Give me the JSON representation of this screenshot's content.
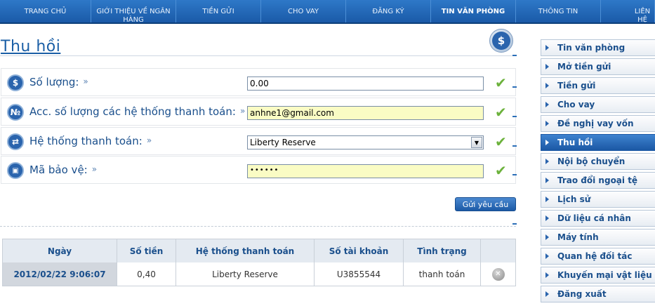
{
  "topnav": {
    "items": [
      {
        "label": "TRANG CHỦ"
      },
      {
        "label": "GIỚI THIỆU VỀ NGÂN HÀNG"
      },
      {
        "label": "TIỀN GỬI"
      },
      {
        "label": "CHO VAY"
      },
      {
        "label": "ĐĂNG KÝ"
      },
      {
        "label": "TIN VĂN PHÒNG"
      },
      {
        "label": "THÔNG TIN"
      },
      {
        "label": "LIÊN HỆ"
      }
    ],
    "active_index": 5
  },
  "page": {
    "title": "Thu hồi",
    "sign_icon_glyph": "$"
  },
  "form": {
    "chevron": "»",
    "rows": [
      {
        "label": "Số lượng:",
        "icon": "dollar-icon",
        "icon_glyph": "$",
        "value": "0.00",
        "type": "text"
      },
      {
        "label": "Acc. số lượng các hệ thống thanh toán:",
        "icon": "numero-icon",
        "icon_glyph": "№",
        "value": "anhne1@gmail.com",
        "type": "text-yellow"
      },
      {
        "label": "Hệ thống thanh toán:",
        "icon": "exchange-icon",
        "icon_glyph": "⇄",
        "value": "Liberty Reserve",
        "type": "select"
      },
      {
        "label": "Mã bảo vệ:",
        "icon": "lock-icon",
        "icon_glyph": "🔒",
        "value": "••••••",
        "type": "password"
      }
    ],
    "check_glyph": "✔",
    "submit_label": "Gửi yêu cầu"
  },
  "table": {
    "columns": [
      "Ngày",
      "Số tiền",
      "Hệ thống thanh toán",
      "Số tài khoản",
      "Tình trạng",
      ""
    ],
    "rows": [
      {
        "date": "2012/02/22 9:06:07",
        "amount": "0,40",
        "system": "Liberty Reserve",
        "account": "U3855544",
        "status": "thanh toán"
      }
    ],
    "delete_glyph": "✕"
  },
  "sidebar": {
    "items": [
      {
        "label": "Tin văn phòng"
      },
      {
        "label": "Mở tiền gửi"
      },
      {
        "label": "Tiền gửi"
      },
      {
        "label": "Cho vay"
      },
      {
        "label": "Đề nghị vay vốn"
      },
      {
        "label": "Thu hồi"
      },
      {
        "label": "Nội bộ chuyển"
      },
      {
        "label": "Trao đổi ngoại tệ"
      },
      {
        "label": "Lịch sử"
      },
      {
        "label": "Dữ liệu cá nhân"
      },
      {
        "label": "Máy tính"
      },
      {
        "label": "Quan hệ đối tác"
      },
      {
        "label": "Khuyến mại vật liệu"
      },
      {
        "label": "Đăng xuất"
      }
    ],
    "active_index": 5
  },
  "colors": {
    "accent": "#1b5fa6",
    "nav": "#1a5aa8",
    "check": "#6cb23c",
    "input_yellow": "#fafcc4"
  }
}
